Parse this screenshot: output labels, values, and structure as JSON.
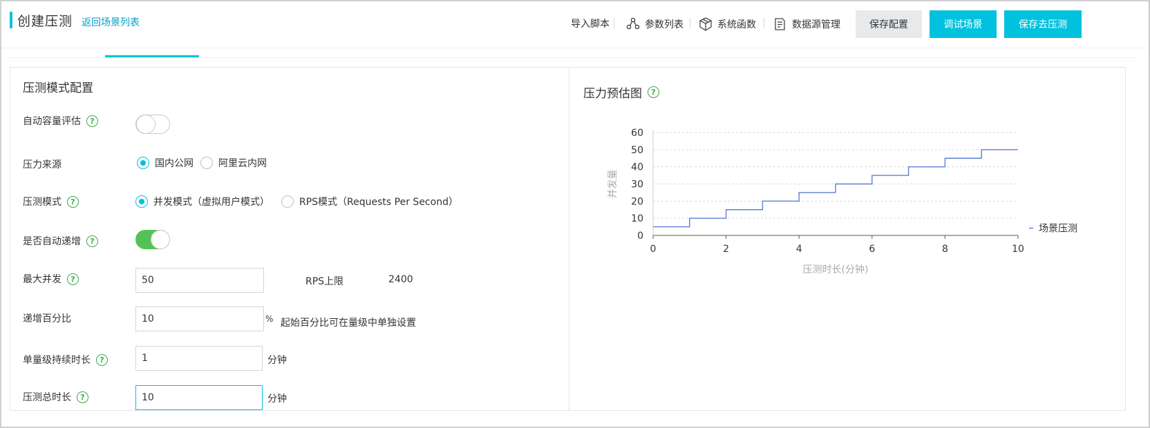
{
  "header": {
    "title": "创建压测",
    "back_link": "返回场景列表",
    "tools": [
      {
        "label": "导入脚本",
        "icon": "none"
      },
      {
        "label": "参数列表",
        "icon": "share-nodes-icon"
      },
      {
        "label": "系统函数",
        "icon": "cube-icon"
      },
      {
        "label": "数据源管理",
        "icon": "document-edit-icon"
      }
    ],
    "buttons": {
      "save_config": "保存配置",
      "debug_scene": "调试场景",
      "save_run": "保存去压测"
    }
  },
  "left_panel": {
    "title": "压测模式配置",
    "auto_capacity": {
      "label": "自动容量评估",
      "enabled": false
    },
    "pressure_source": {
      "label": "压力来源",
      "options": [
        "国内公网",
        "阿里云内网"
      ],
      "selected": "国内公网"
    },
    "test_mode": {
      "label": "压测模式",
      "options": [
        "并发模式（虚拟用户模式）",
        "RPS模式（Requests Per Second）"
      ],
      "selected": "并发模式（虚拟用户模式）"
    },
    "auto_increase": {
      "label": "是否自动递增",
      "enabled": true
    },
    "max_concurrency": {
      "label": "最大并发",
      "value": "50",
      "rps_label": "RPS上限",
      "rps_value": "2400"
    },
    "increment_percent": {
      "label": "递增百分比",
      "value": "10",
      "unit": "%",
      "hint": "起始百分比可在量级中单独设置"
    },
    "level_duration": {
      "label": "单量级持续时长",
      "value": "1",
      "unit": "分钟"
    },
    "total_duration": {
      "label": "压测总时长",
      "value": "10",
      "unit": "分钟"
    }
  },
  "right_panel": {
    "title": "压力预估图"
  },
  "colors": {
    "accent": "#00c1de",
    "toggle_on": "#52c457",
    "help": "#3aaa47",
    "line": "#5b7fd6"
  },
  "chart_data": {
    "type": "line",
    "step": true,
    "xlabel": "压测时长(分钟)",
    "ylabel": "并发量",
    "xlim": [
      0,
      10
    ],
    "ylim": [
      0,
      60
    ],
    "xticks": [
      0,
      2,
      4,
      6,
      8,
      10
    ],
    "yticks": [
      0,
      10,
      20,
      30,
      40,
      50,
      60
    ],
    "grid": true,
    "legend": "right",
    "series": [
      {
        "name": "场景压测",
        "x": [
          0,
          1,
          2,
          3,
          4,
          5,
          6,
          7,
          8,
          9,
          10
        ],
        "y": [
          5,
          10,
          15,
          20,
          25,
          30,
          35,
          40,
          45,
          50,
          50
        ]
      }
    ]
  }
}
